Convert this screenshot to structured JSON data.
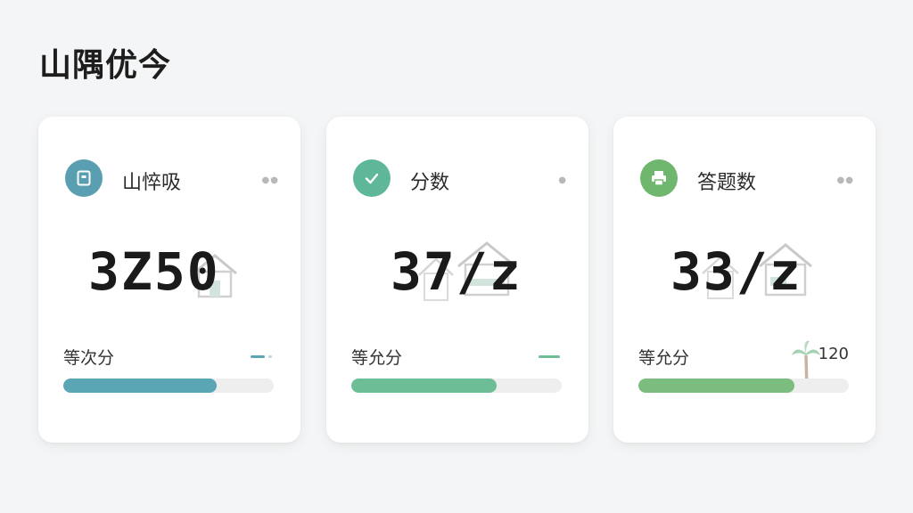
{
  "page": {
    "title": "山隅优今"
  },
  "cards": [
    {
      "title": "山悴吸",
      "value": "3Z50",
      "avg_label": "等次分",
      "extra": "",
      "progress": 0.73,
      "accent": "#5aa6b4",
      "icon_bg": "#5a9fb1",
      "icon": "document-icon"
    },
    {
      "title": "分数",
      "value": "37/z",
      "avg_label": "等允分",
      "extra": "",
      "progress": 0.69,
      "accent": "#6dbd97",
      "icon_bg": "#5fb79a",
      "icon": "check-icon"
    },
    {
      "title": "答题数",
      "value": "33/z",
      "avg_label": "等允分",
      "extra": "120",
      "progress": 0.74,
      "accent": "#7bbd7f",
      "icon_bg": "#6fb66f",
      "icon": "printer-icon"
    }
  ]
}
